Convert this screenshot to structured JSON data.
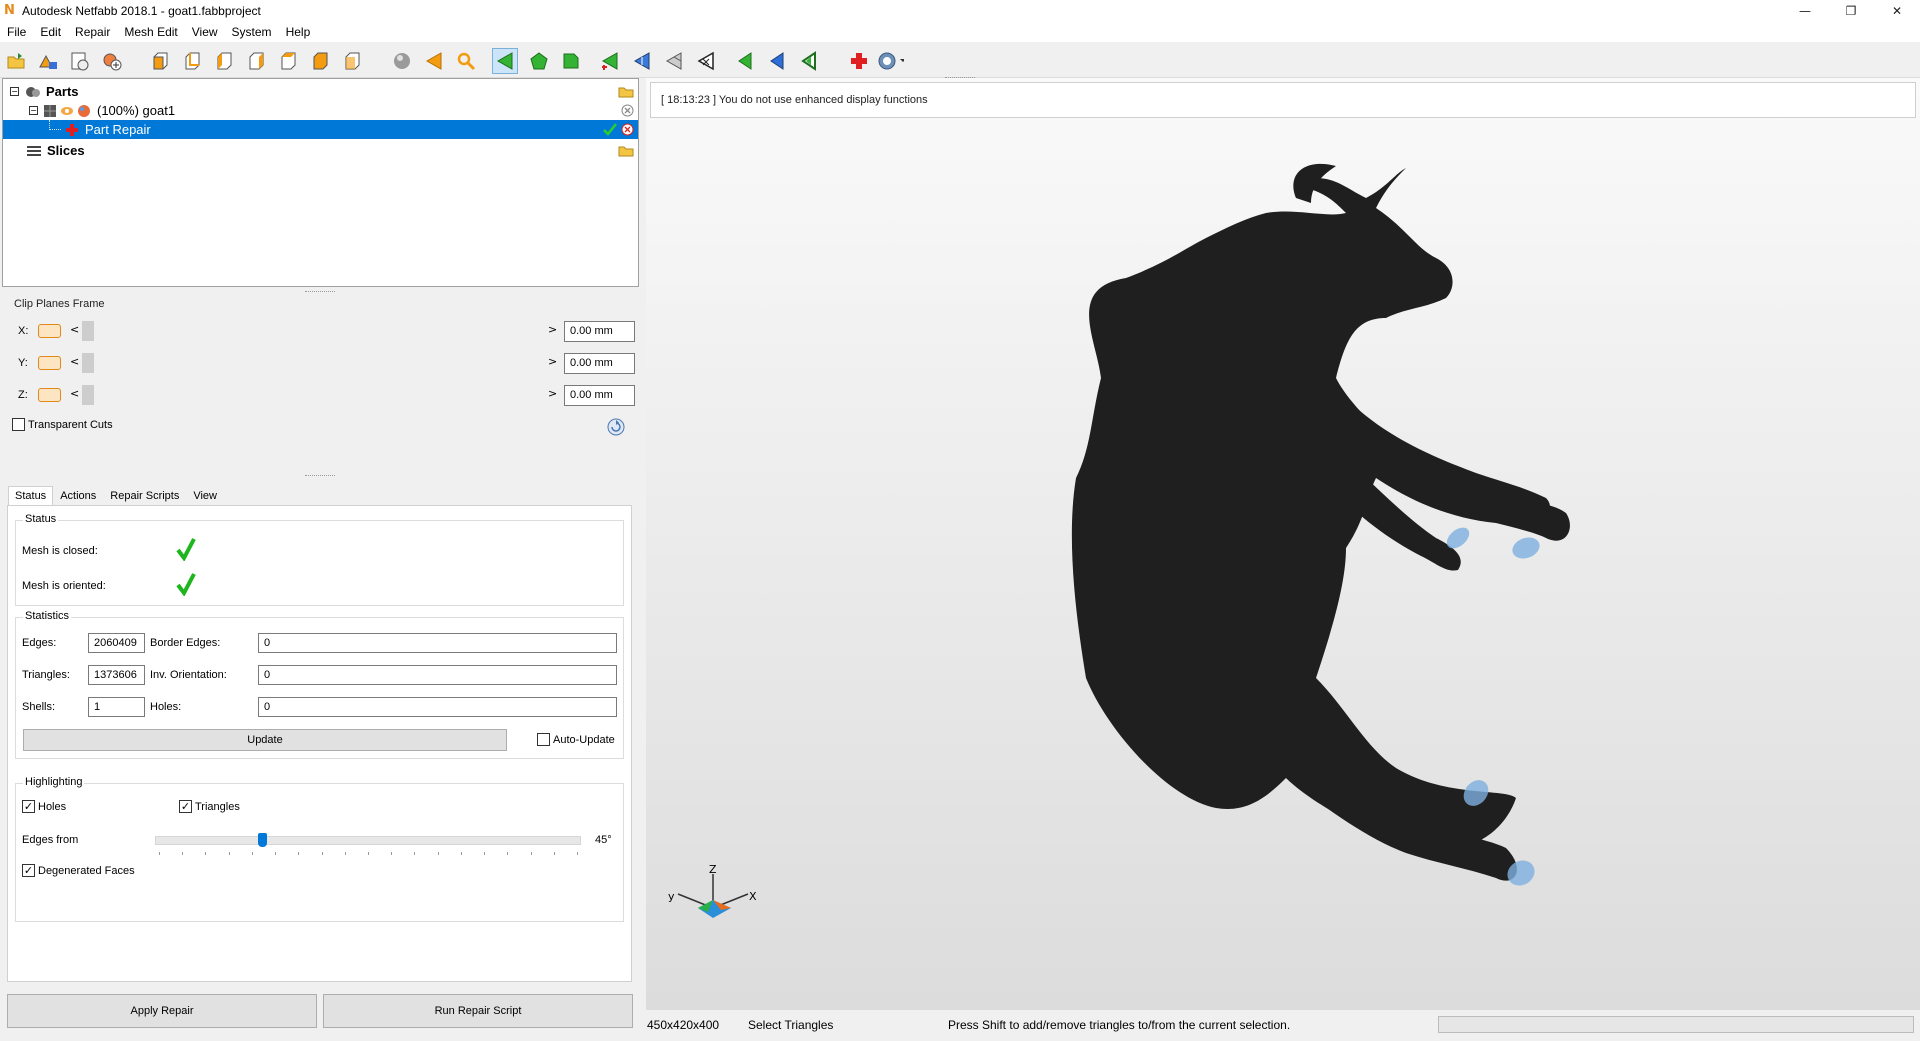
{
  "window": {
    "title": "Autodesk Netfabb 2018.1 - goat1.fabbproject",
    "logo_letter": "N",
    "minimize_glyph": "—",
    "restore_glyph": "❐",
    "close_glyph": "✕"
  },
  "menu": [
    "File",
    "Edit",
    "Repair",
    "Mesh Edit",
    "View",
    "System",
    "Help"
  ],
  "toolbar": {
    "icons": [
      "open-project-icon",
      "add-part-icon",
      "new-project-icon",
      "add-icon",
      "view-front-icon",
      "view-back-icon",
      "view-left-icon",
      "view-right-icon",
      "view-top-icon",
      "view-bottom-icon",
      "view-iso-icon",
      "sphere-icon",
      "arrow-left-icon",
      "zoom-icon",
      "select-triangles-icon",
      "select-surface-icon",
      "select-shell-icon",
      "triangle-add-icon",
      "triangle-split-icon",
      "triangle-mesh-icon",
      "triangle-remove-icon",
      "navigate-green-icon",
      "navigate-blue-icon",
      "navigate-hollow-icon",
      "repair-cross-icon",
      "help-icon"
    ]
  },
  "tree": {
    "parts_label": "Parts",
    "part_label": "(100%) goat1",
    "repair_label": "Part Repair",
    "slices_label": "Slices"
  },
  "clip": {
    "title": "Clip Planes Frame",
    "x_label": "X:",
    "y_label": "Y:",
    "z_label": "Z:",
    "x_value": "0.00 mm",
    "y_value": "0.00 mm",
    "z_value": "0.00 mm",
    "left_arrow": "<",
    "right_arrow": ">",
    "transparent_label": "Transparent Cuts"
  },
  "tabs": [
    "Status",
    "Actions",
    "Repair Scripts",
    "View"
  ],
  "status": {
    "group": "Status",
    "closed_label": "Mesh is closed:",
    "oriented_label": "Mesh is oriented:"
  },
  "statistics": {
    "group": "Statistics",
    "edges_label": "Edges:",
    "edges_value": "2060409",
    "border_edges_label": "Border Edges:",
    "border_edges_value": "0",
    "triangles_label": "Triangles:",
    "triangles_value": "1373606",
    "inv_orientation_label": "Inv. Orientation:",
    "inv_orientation_value": "0",
    "shells_label": "Shells:",
    "shells_value": "1",
    "holes_label": "Holes:",
    "holes_value": "0",
    "update_label": "Update",
    "auto_update_label": "Auto-Update"
  },
  "highlighting": {
    "group": "Highlighting",
    "holes_label": "Holes",
    "triangles_label": "Triangles",
    "edges_from_label": "Edges from",
    "edges_from_value": "45°",
    "degenerated_label": "Degenerated Faces",
    "check_glyph": "✓"
  },
  "buttons": {
    "apply_repair": "Apply Repair",
    "run_script": "Run Repair Script"
  },
  "viewport": {
    "log_message": "[ 18:13:23 ] You do not use enhanced display functions",
    "axis_z": "Z",
    "axis_x": "X",
    "axis_y": "y"
  },
  "statusbar": {
    "dimensions": "450x420x400",
    "mode": "Select Triangles",
    "hint": "Press Shift to add/remove triangles to/from the current selection."
  }
}
